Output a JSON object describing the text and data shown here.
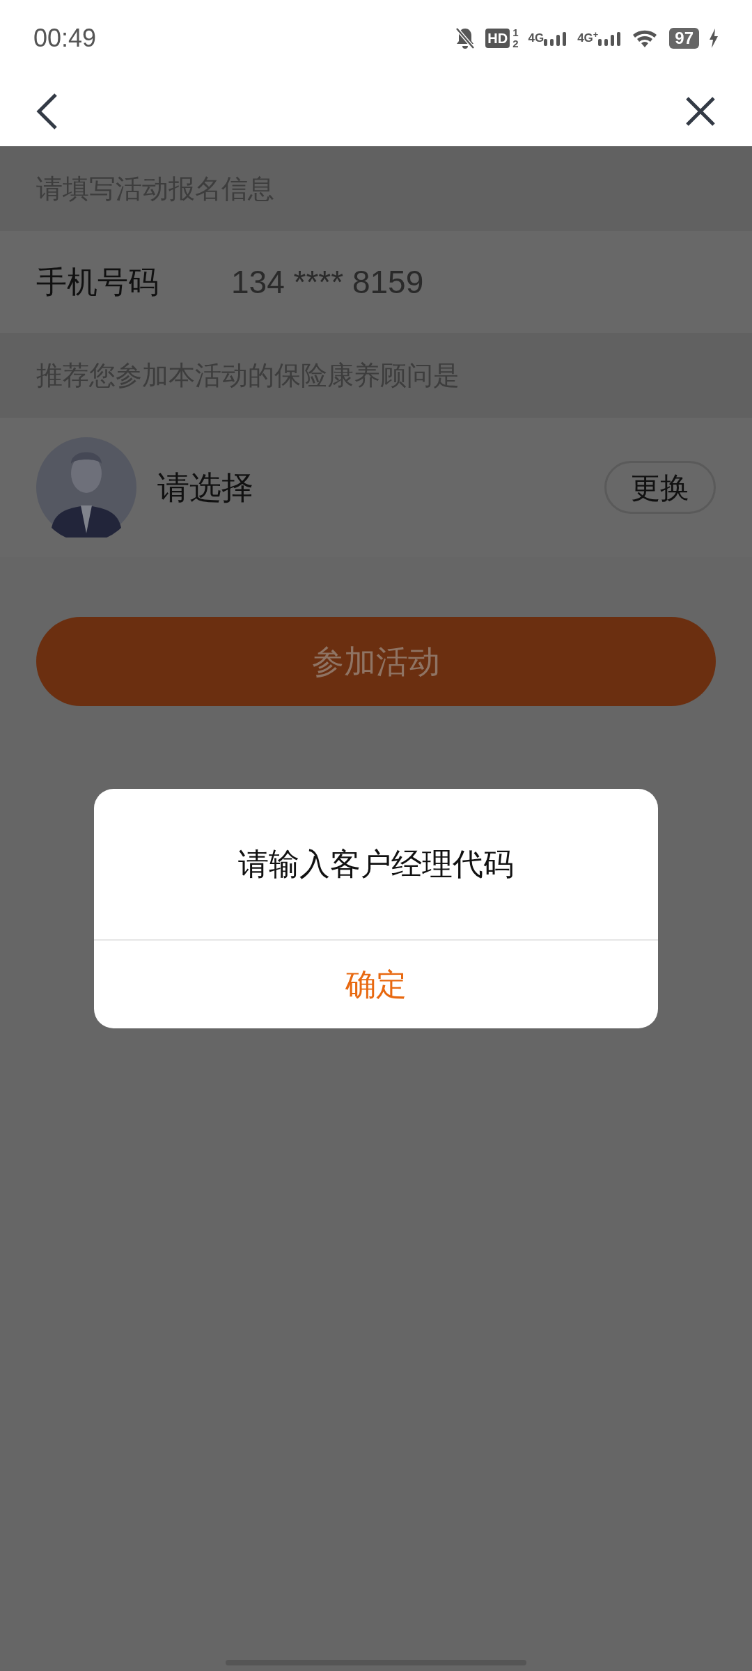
{
  "status_bar": {
    "time": "00:49",
    "hd": "HD",
    "hd_sims": [
      "1",
      "2"
    ],
    "networks": [
      "4G",
      "4G$^{+}$"
    ],
    "battery": "97"
  },
  "form": {
    "section_title": "请填写活动报名信息",
    "phone_label": "手机号码",
    "phone_value": "134 **** 8159",
    "advisor_title": "推荐您参加本活动的保险康养顾问是",
    "advisor_choice": "请选择",
    "change_button": "更换",
    "submit_button": "参加活动"
  },
  "dialog": {
    "message": "请输入客户经理代码",
    "confirm": "确定"
  }
}
